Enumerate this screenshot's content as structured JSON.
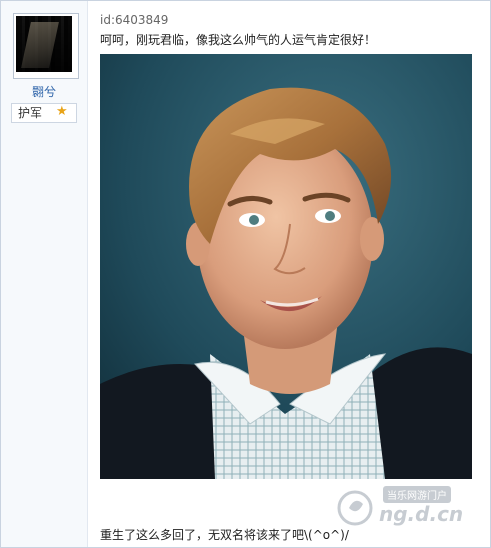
{
  "user": {
    "username": "翾兮",
    "rank": "护军",
    "avatar_icon": "avatar-image"
  },
  "post": {
    "id": "id:6403849",
    "text": "呵呵，刚玩君临，像我这么帅气的人运气肯定很好！",
    "footer": "重生了这么多回了，无双名将该来了吧\\(^o^)/"
  },
  "watermark": {
    "tagline": "当乐网游门户",
    "domain": "ng.d.cn"
  },
  "colors": {
    "username": "#2b62a8",
    "border": "#c9d3e0",
    "sidebar_bg": "#f6f9fc",
    "photo_bg": "#1e4555"
  }
}
